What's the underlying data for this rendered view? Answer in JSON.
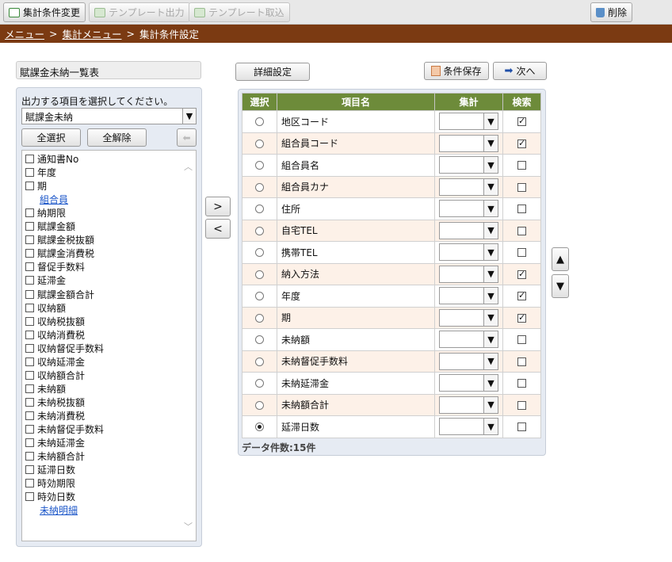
{
  "toolbar": {
    "aggregate_condition_change": "集計条件変更",
    "template_output": "テンプレート出力",
    "template_import": "テンプレート取込",
    "delete": "削除"
  },
  "breadcrumb": {
    "menu": "メニュー",
    "aggregate_menu": "集計メニュー",
    "current": "集計条件設定",
    "separator": ">"
  },
  "left": {
    "report_title": "賦課金未納一覧表",
    "hint": "出力する項目を選択してください。",
    "category_select": "賦課金未納",
    "select_all": "全選択",
    "deselect_all": "全解除",
    "items": [
      {
        "label": "通知書No",
        "type": "check"
      },
      {
        "label": "年度",
        "type": "check"
      },
      {
        "label": "期",
        "type": "check"
      },
      {
        "label": "組合員",
        "type": "link"
      },
      {
        "label": "納期限",
        "type": "check"
      },
      {
        "label": "賦課金額",
        "type": "check"
      },
      {
        "label": "賦課金税抜額",
        "type": "check"
      },
      {
        "label": "賦課金消費税",
        "type": "check"
      },
      {
        "label": "督促手数料",
        "type": "check"
      },
      {
        "label": "延滞金",
        "type": "check"
      },
      {
        "label": "賦課金額合計",
        "type": "check"
      },
      {
        "label": "収納額",
        "type": "check"
      },
      {
        "label": "収納税抜額",
        "type": "check"
      },
      {
        "label": "収納消費税",
        "type": "check"
      },
      {
        "label": "収納督促手数料",
        "type": "check"
      },
      {
        "label": "収納延滞金",
        "type": "check"
      },
      {
        "label": "収納額合計",
        "type": "check"
      },
      {
        "label": "未納額",
        "type": "check"
      },
      {
        "label": "未納税抜額",
        "type": "check"
      },
      {
        "label": "未納消費税",
        "type": "check"
      },
      {
        "label": "未納督促手数料",
        "type": "check"
      },
      {
        "label": "未納延滞金",
        "type": "check"
      },
      {
        "label": "未納額合計",
        "type": "check"
      },
      {
        "label": "延滞日数",
        "type": "check"
      },
      {
        "label": "時効期限",
        "type": "check"
      },
      {
        "label": "時効日数",
        "type": "check"
      },
      {
        "label": "未納明細",
        "type": "link"
      }
    ]
  },
  "move": {
    "add": ">",
    "remove": "<"
  },
  "right": {
    "detail_settings": "詳細設定",
    "save_conditions": "条件保存",
    "next": "次へ",
    "headers": {
      "select": "選択",
      "item_name": "項目名",
      "aggregate": "集計",
      "search": "検索"
    },
    "rows": [
      {
        "name": "地区コード",
        "selected": false,
        "search": true
      },
      {
        "name": "組合員コード",
        "selected": false,
        "search": true
      },
      {
        "name": "組合員名",
        "selected": false,
        "search": false
      },
      {
        "name": "組合員カナ",
        "selected": false,
        "search": false
      },
      {
        "name": "住所",
        "selected": false,
        "search": false
      },
      {
        "name": "自宅TEL",
        "selected": false,
        "search": false
      },
      {
        "name": "携帯TEL",
        "selected": false,
        "search": false
      },
      {
        "name": "納入方法",
        "selected": false,
        "search": true
      },
      {
        "name": "年度",
        "selected": false,
        "search": true
      },
      {
        "name": "期",
        "selected": false,
        "search": true
      },
      {
        "name": "未納額",
        "selected": false,
        "search": false
      },
      {
        "name": "未納督促手数料",
        "selected": false,
        "search": false
      },
      {
        "name": "未納延滞金",
        "selected": false,
        "search": false
      },
      {
        "name": "未納額合計",
        "selected": false,
        "search": false
      },
      {
        "name": "延滞日数",
        "selected": true,
        "search": false
      }
    ],
    "count_label": "データ件数:15件"
  },
  "order": {
    "up": "▲",
    "down": "▼"
  },
  "colors": {
    "header_green": "#6d8b3a",
    "breadcrumb_brown": "#7b3a12",
    "row_alt": "#fdf1e8",
    "link_blue": "#1a55c8"
  }
}
